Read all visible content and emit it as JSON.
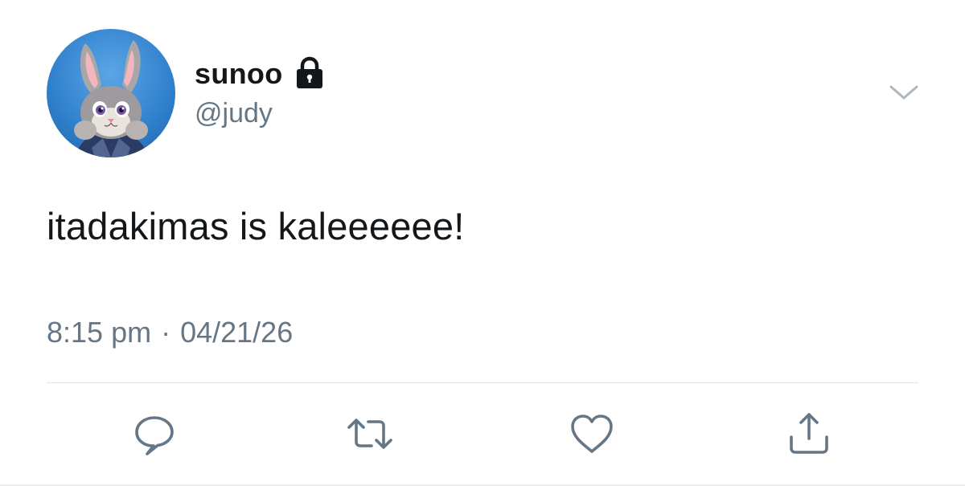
{
  "user": {
    "display_name": "sunoo",
    "handle": "@judy",
    "protected_icon": "lock-icon",
    "avatar": "avatar-bunny"
  },
  "tweet": {
    "text": "itadakimas is kaleeeeee!",
    "time": "8:15 pm",
    "separator": "·",
    "date": "04/21/26"
  },
  "menu_icon": "chevron-down-icon",
  "actions": [
    {
      "name": "reply",
      "icon": "speech-bubble-icon"
    },
    {
      "name": "retweet",
      "icon": "retweet-icon"
    },
    {
      "name": "like",
      "icon": "heart-icon"
    },
    {
      "name": "share",
      "icon": "share-icon"
    }
  ],
  "colors": {
    "text": "#14171a",
    "secondary": "#657786",
    "divider": "#e1e8ed",
    "avatar_bg": "#2f7fcc"
  }
}
